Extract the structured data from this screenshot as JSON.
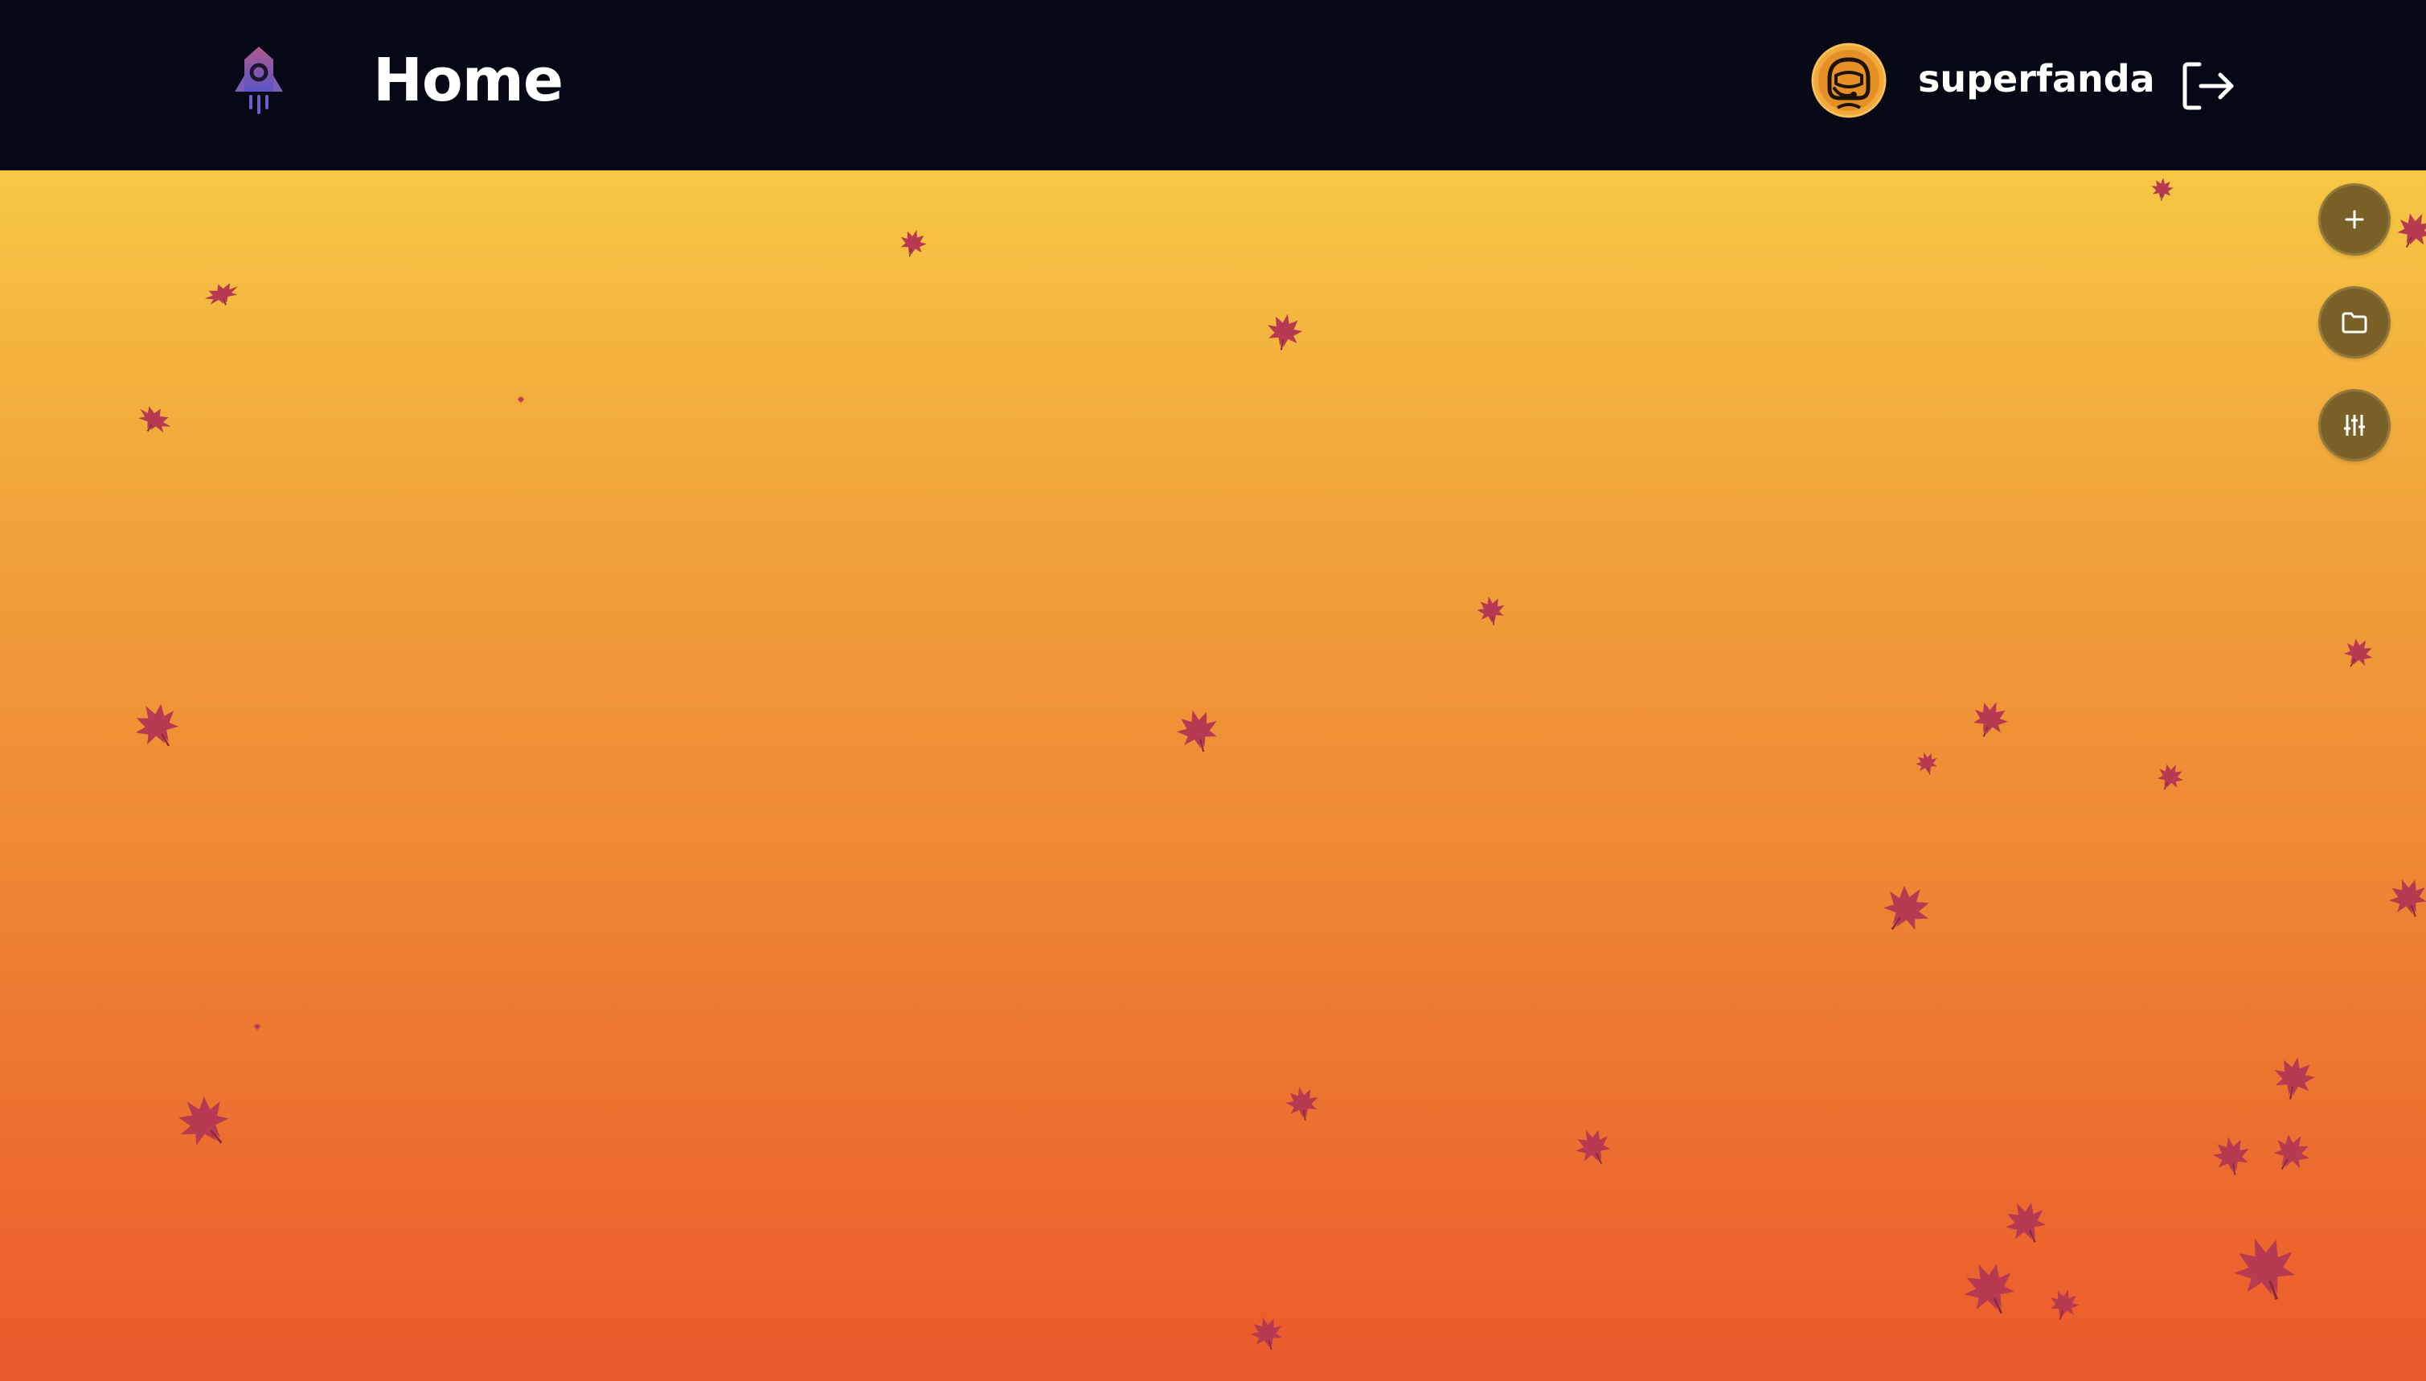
{
  "header": {
    "title": "Home",
    "username": "superfanda"
  },
  "icons": {
    "logo": "rocket-icon",
    "avatar": "astronaut-avatar-icon",
    "logout": "logout-icon",
    "add": "plus-icon",
    "folder": "folder-icon",
    "settings": "sliders-icon",
    "decoration": "falling-leaf-icon"
  },
  "colors": {
    "header_bg": "#060915",
    "gradient_top": "#f7c744",
    "gradient_bottom": "#eb5a2b",
    "fab_bg": "#7a6128",
    "leaf": "#b83a52",
    "avatar_accent": "#f2a93b"
  }
}
